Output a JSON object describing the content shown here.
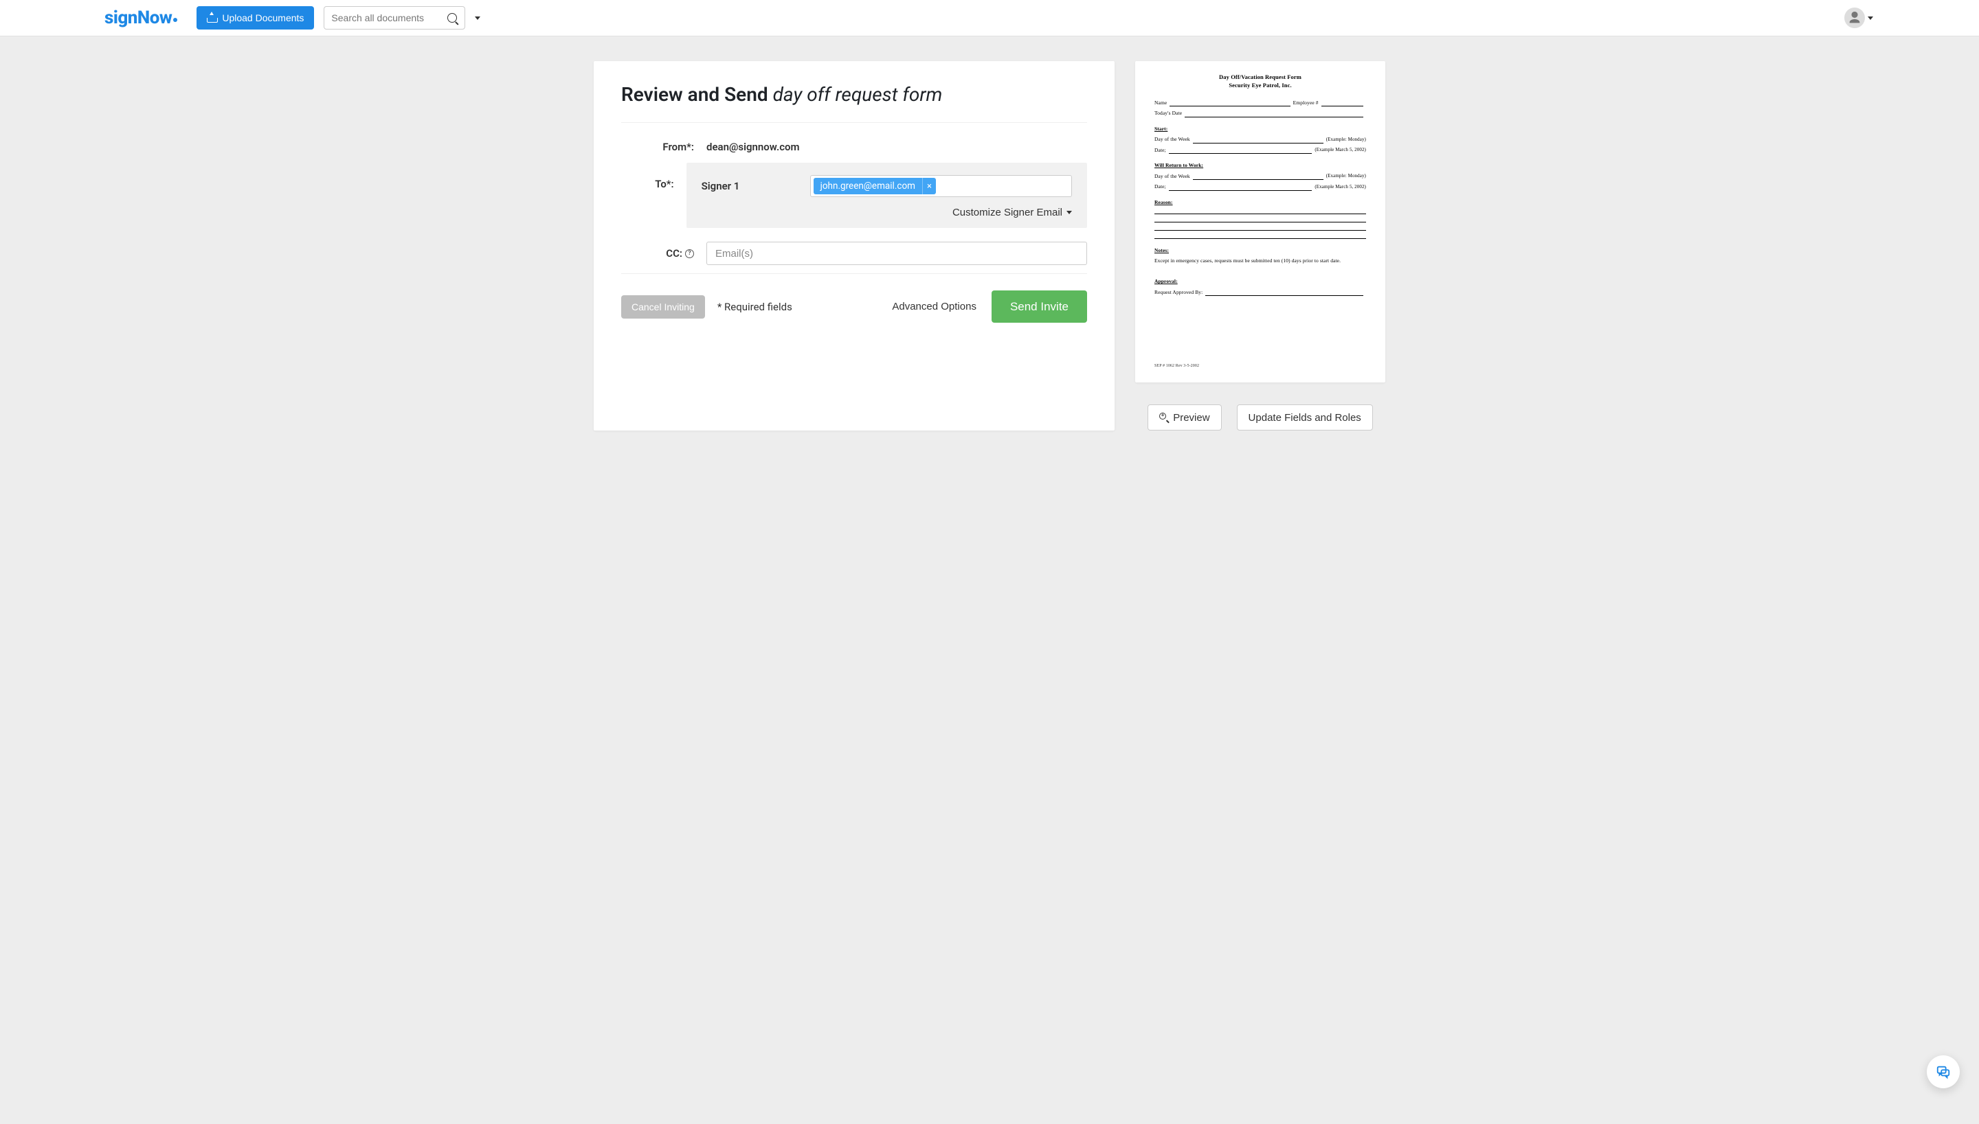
{
  "brand": {
    "name": "signNow"
  },
  "header": {
    "upload_label": "Upload Documents",
    "search_placeholder": "Search all documents"
  },
  "page": {
    "title_prefix": "Review and Send ",
    "doc_name": "day off request form"
  },
  "form": {
    "from_label": "From*:",
    "from_value": "dean@signnow.com",
    "to_label": "To*:",
    "signer_label": "Signer 1",
    "signer_email": "john.green@email.com",
    "customize_label": "Customize Signer Email",
    "cc_label": "CC:",
    "cc_placeholder": "Email(s)"
  },
  "footer": {
    "cancel_label": "Cancel Inviting",
    "required_note": "* Required fields",
    "advanced_label": "Advanced Options",
    "send_label": "Send Invite"
  },
  "side": {
    "preview_btn": "Preview",
    "update_btn": "Update Fields and Roles"
  },
  "doc_preview": {
    "title_line1": "Day Off/Vacation Request Form",
    "title_line2": "Security Eye Patrol, Inc.",
    "name_lbl": "Name",
    "emp_lbl": "Employee #",
    "today_lbl": "Today's Date",
    "start_head": "Start:",
    "dow_lbl": "Day of the Week",
    "dow_hint": "(Example: Monday)",
    "date_lbl": "Date;",
    "date_hint": "(Example March 5, 2002)",
    "return_head": "Will Return to Work:",
    "reason_head": "Reason:",
    "notes_head": "Notes:",
    "notes_text": "Except in emergency cases, requests must be submitted ten (10) days prior to start date.",
    "approval_head": "Approval:",
    "approved_by": "Request Approved By:",
    "footer_code": "SEP # 1062 Rev 3-5-2002"
  }
}
